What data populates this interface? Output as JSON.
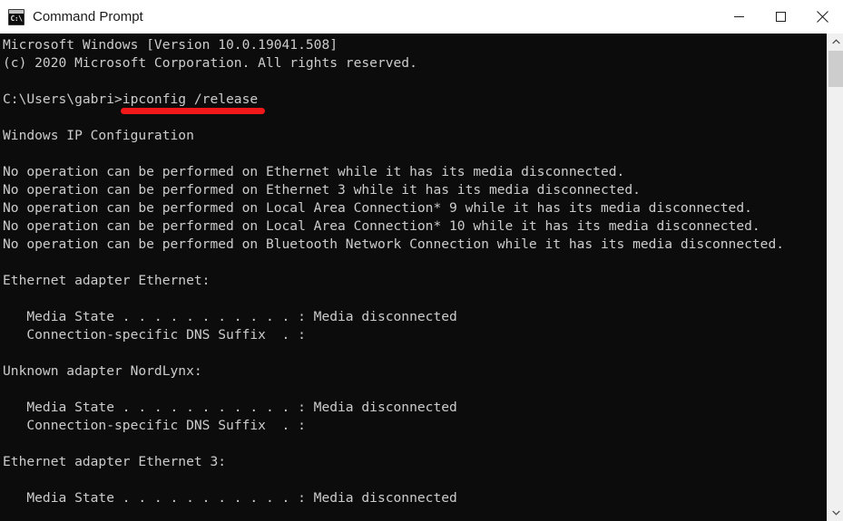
{
  "window": {
    "title": "Command Prompt",
    "icon": "command-prompt-icon",
    "icon_glyph": "C:\\",
    "background_color": "#0c0c0c",
    "titlebar_color": "#ffffff",
    "text_color": "#cccccc"
  },
  "window_controls": {
    "minimize_label": "Minimize",
    "maximize_label": "Maximize",
    "close_label": "Close"
  },
  "terminal": {
    "lines": [
      "Microsoft Windows [Version 10.0.19041.508]",
      "(c) 2020 Microsoft Corporation. All rights reserved.",
      "",
      "C:\\Users\\gabri>ipconfig /release",
      "",
      "Windows IP Configuration",
      "",
      "No operation can be performed on Ethernet while it has its media disconnected.",
      "No operation can be performed on Ethernet 3 while it has its media disconnected.",
      "No operation can be performed on Local Area Connection* 9 while it has its media disconnected.",
      "No operation can be performed on Local Area Connection* 10 while it has its media disconnected.",
      "No operation can be performed on Bluetooth Network Connection while it has its media disconnected.",
      "",
      "Ethernet adapter Ethernet:",
      "",
      "   Media State . . . . . . . . . . . : Media disconnected",
      "   Connection-specific DNS Suffix  . :",
      "",
      "Unknown adapter NordLynx:",
      "",
      "   Media State . . . . . . . . . . . : Media disconnected",
      "   Connection-specific DNS Suffix  . :",
      "",
      "Ethernet adapter Ethernet 3:",
      "",
      "   Media State . . . . . . . . . . . : Media disconnected"
    ],
    "prompt": "C:\\Users\\gabri>",
    "command": "ipconfig /release"
  },
  "annotation": {
    "type": "underline",
    "color": "#f01818",
    "target_text": "ipconfig /release"
  },
  "scrollbar": {
    "up_arrow": "chevron-up-icon",
    "down_arrow": "chevron-down-icon",
    "thumb_position_percent": 3
  }
}
